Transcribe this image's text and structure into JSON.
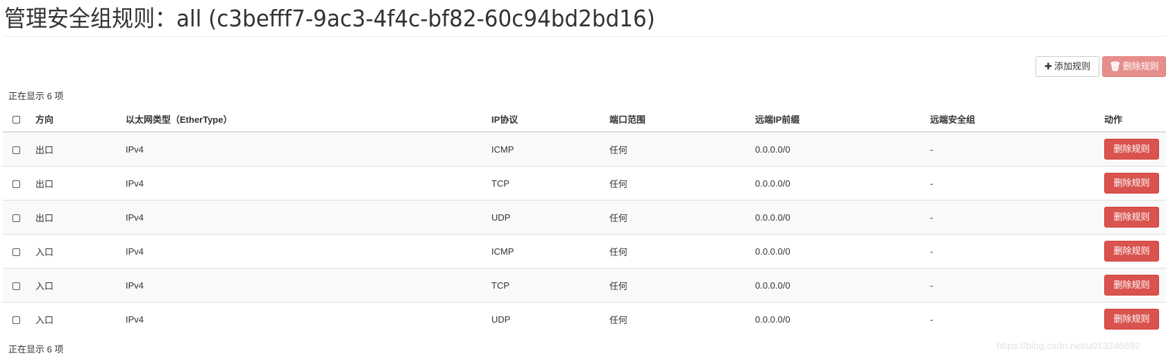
{
  "header": {
    "title": "管理安全组规则：all (c3befff7-9ac3-4f4c-bf82-60c94bd2bd16)"
  },
  "toolbar": {
    "add_label": "添加规则",
    "add_icon": "plus-icon",
    "delete_label": "删除规则",
    "delete_icon": "trash-icon"
  },
  "summary": {
    "top": "正在显示 6 项",
    "bottom": "正在显示 6 项"
  },
  "table": {
    "columns": [
      "方向",
      "以太网类型（EtherType）",
      "IP协议",
      "端口范围",
      "远端IP前缀",
      "远端安全组",
      "动作"
    ],
    "rows": [
      {
        "direction": "出口",
        "ethertype": "IPv4",
        "protocol": "ICMP",
        "port_range": "任何",
        "remote_ip_prefix": "0.0.0.0/0",
        "remote_sg": "-",
        "action": "删除规则"
      },
      {
        "direction": "出口",
        "ethertype": "IPv4",
        "protocol": "TCP",
        "port_range": "任何",
        "remote_ip_prefix": "0.0.0.0/0",
        "remote_sg": "-",
        "action": "删除规则"
      },
      {
        "direction": "出口",
        "ethertype": "IPv4",
        "protocol": "UDP",
        "port_range": "任何",
        "remote_ip_prefix": "0.0.0.0/0",
        "remote_sg": "-",
        "action": "删除规则"
      },
      {
        "direction": "入口",
        "ethertype": "IPv4",
        "protocol": "ICMP",
        "port_range": "任何",
        "remote_ip_prefix": "0.0.0.0/0",
        "remote_sg": "-",
        "action": "删除规则"
      },
      {
        "direction": "入口",
        "ethertype": "IPv4",
        "protocol": "TCP",
        "port_range": "任何",
        "remote_ip_prefix": "0.0.0.0/0",
        "remote_sg": "-",
        "action": "删除规则"
      },
      {
        "direction": "入口",
        "ethertype": "IPv4",
        "protocol": "UDP",
        "port_range": "任何",
        "remote_ip_prefix": "0.0.0.0/0",
        "remote_sg": "-",
        "action": "删除规则"
      }
    ]
  },
  "watermark": "https://blog.csdn.net/u013246692",
  "colors": {
    "danger": "#d9534f",
    "border": "#dddddd",
    "stripe": "#f9f9f9"
  }
}
